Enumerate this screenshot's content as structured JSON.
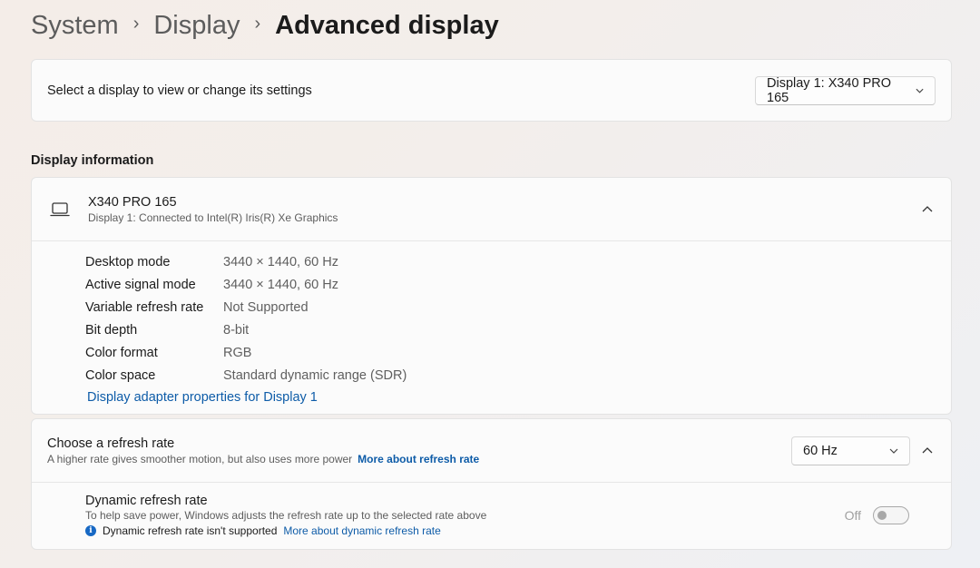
{
  "breadcrumb": {
    "items": [
      "System",
      "Display"
    ],
    "current": "Advanced display"
  },
  "select_display": {
    "label": "Select a display to view or change its settings",
    "selected": "Display 1: X340 PRO 165"
  },
  "display_info": {
    "section_title": "Display information",
    "monitor_name": "X340 PRO 165",
    "connection": "Display 1: Connected to Intel(R) Iris(R) Xe Graphics",
    "properties": [
      {
        "key": "Desktop mode",
        "value": "3440 × 1440, 60 Hz"
      },
      {
        "key": "Active signal mode",
        "value": "3440 × 1440, 60 Hz"
      },
      {
        "key": "Variable refresh rate",
        "value": "Not Supported"
      },
      {
        "key": "Bit depth",
        "value": "8-bit"
      },
      {
        "key": "Color format",
        "value": "RGB"
      },
      {
        "key": "Color space",
        "value": "Standard dynamic range (SDR)"
      }
    ],
    "adapter_link": "Display adapter properties for Display 1"
  },
  "refresh_rate": {
    "title": "Choose a refresh rate",
    "description": "A higher rate gives smoother motion, but also uses more power",
    "link": "More about refresh rate",
    "selected": "60 Hz"
  },
  "dynamic_refresh": {
    "title": "Dynamic refresh rate",
    "description": "To help save power, Windows adjusts the refresh rate up to the selected rate above",
    "warning": "Dynamic refresh rate isn't supported",
    "link": "More about dynamic refresh rate",
    "toggle_label": "Off",
    "toggle_on": false
  },
  "icons": {
    "chevron_right": "chevron-right-icon",
    "chevron_down": "chevron-down-icon",
    "chevron_up": "chevron-up-icon",
    "laptop": "laptop-icon",
    "info": "info-icon"
  },
  "colors": {
    "link": "#0e5ca8",
    "info_badge": "#1768c4",
    "card_bg": "#fbfbfb"
  }
}
